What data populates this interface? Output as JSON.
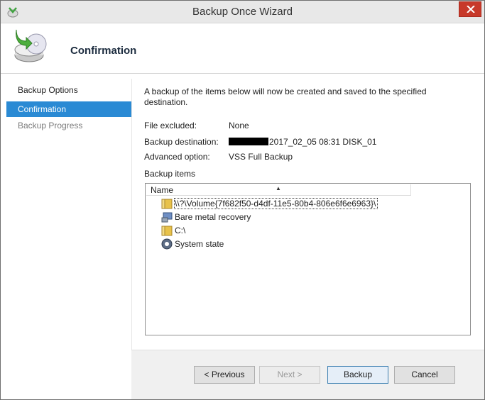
{
  "window": {
    "title": "Backup Once Wizard",
    "close_symbol": "close-icon",
    "accent_close": "#c7392a"
  },
  "header": {
    "page_title": "Confirmation",
    "icon": "backup-disk-icon"
  },
  "nav": {
    "items": [
      {
        "label": "Backup Options",
        "state": "done"
      },
      {
        "label": "Confirmation",
        "state": "active"
      },
      {
        "label": "Backup Progress",
        "state": "pending"
      }
    ],
    "active_color": "#2a8ad4"
  },
  "content": {
    "intro": "A backup of the items below will now be created and saved to the specified destination.",
    "fields": [
      {
        "label": "File excluded:",
        "value": "None"
      },
      {
        "label": "Backup destination:",
        "value": "2017_02_05 08:31 DISK_01"
      },
      {
        "label": "Advanced option:",
        "value": "VSS Full Backup"
      }
    ],
    "items_label": "Backup items",
    "list": {
      "column_header": "Name",
      "rows": [
        {
          "label": "\\\\?\\Volume{7f682f50-d4df-11e5-80b4-806e6f6e6963}\\",
          "icon": "folder-icon"
        },
        {
          "label": "Bare metal recovery",
          "icon": "bare-metal-icon"
        },
        {
          "label": "C:\\",
          "icon": "folder-icon"
        },
        {
          "label": "System state",
          "icon": "system-state-icon"
        }
      ]
    }
  },
  "buttons": {
    "previous": "< Previous",
    "next": "Next >",
    "backup": "Backup",
    "cancel": "Cancel"
  }
}
